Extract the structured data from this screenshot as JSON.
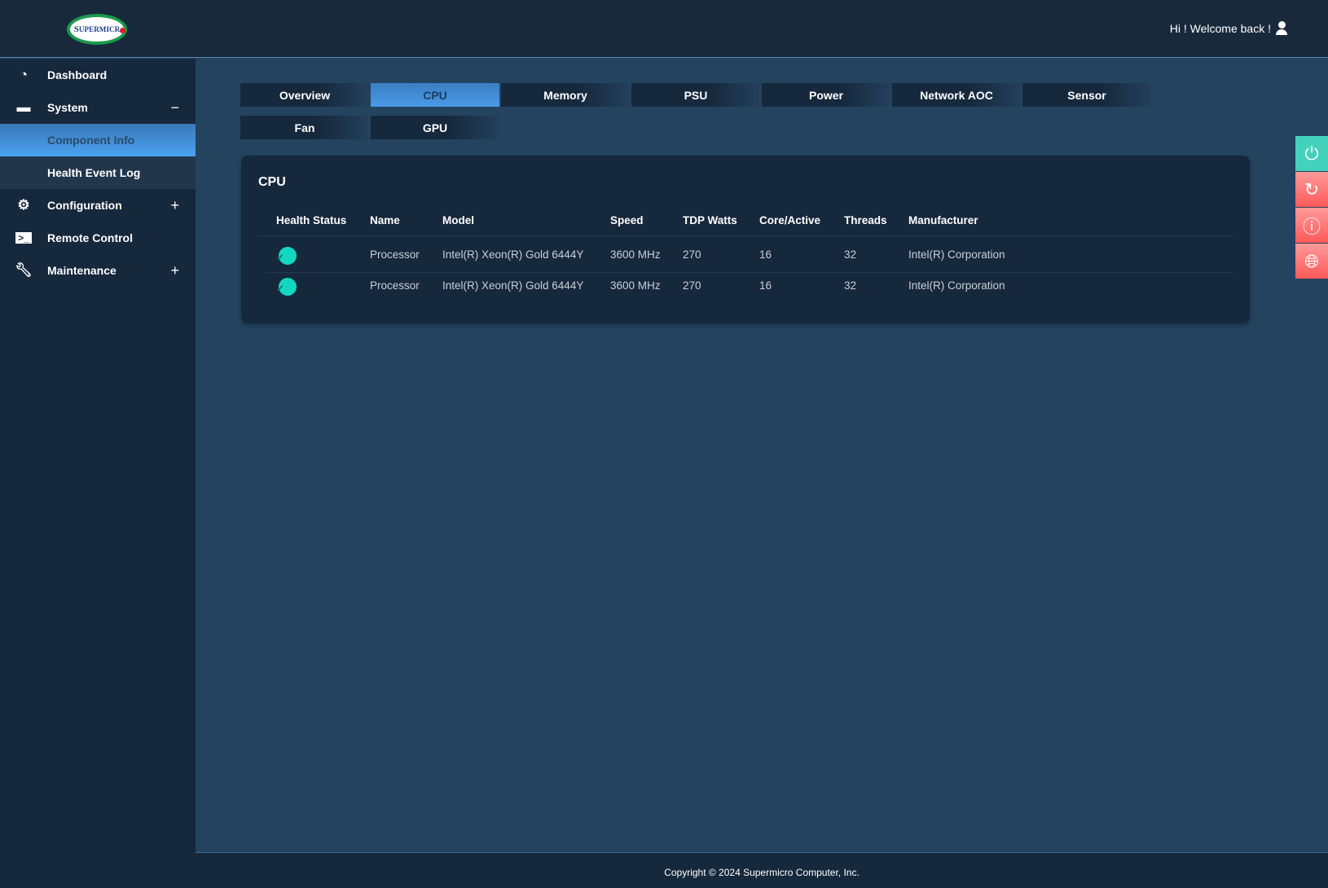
{
  "header": {
    "logo": "SUPERMICRO",
    "welcome": "Hi ! Welcome back !"
  },
  "sidebar": {
    "items": [
      {
        "label": "Dashboard",
        "icon": "dashboard-icon"
      },
      {
        "label": "System",
        "icon": "monitor-icon",
        "toggle": "−"
      },
      {
        "label": "Component Info"
      },
      {
        "label": "Health Event Log"
      },
      {
        "label": "Configuration",
        "icon": "gear-icon",
        "toggle": "+"
      },
      {
        "label": "Remote Control",
        "icon": "terminal-icon"
      },
      {
        "label": "Maintenance",
        "icon": "wrench-icon",
        "toggle": "+"
      }
    ]
  },
  "tabs": [
    "Overview",
    "CPU",
    "Memory",
    "PSU",
    "Power",
    "Network AOC",
    "Sensor",
    "Fan",
    "GPU"
  ],
  "card": {
    "title": "CPU",
    "columns": [
      "Health Status",
      "Name",
      "Model",
      "Speed",
      "TDP Watts",
      "Core/Active",
      "Threads",
      "Manufacturer"
    ],
    "rows": [
      [
        "ok",
        "Processor",
        "Intel(R) Xeon(R) Gold 6444Y",
        "3600 MHz",
        "270",
        "16",
        "32",
        "Intel(R) Corporation"
      ],
      [
        "ok",
        "Processor",
        "Intel(R) Xeon(R) Gold 6444Y",
        "3600 MHz",
        "270",
        "16",
        "32",
        "Intel(R) Corporation"
      ]
    ]
  },
  "quick_actions": [
    "power-icon",
    "refresh-icon",
    "info-icon",
    "globe-icon"
  ],
  "colors": {
    "accent": "#4a9ae8",
    "ok": "#13d8c0",
    "danger": "#ff6a6a",
    "power": "#44d1bc"
  },
  "footer": "Copyright © 2024 Supermicro Computer, Inc."
}
